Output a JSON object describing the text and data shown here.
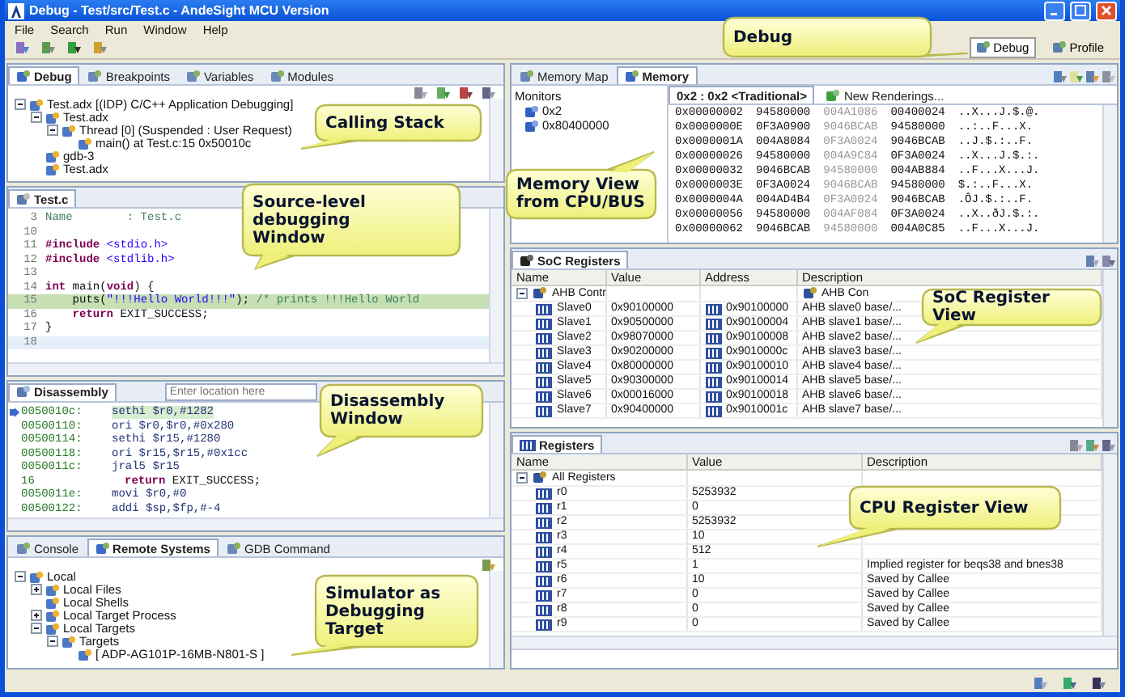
{
  "window": {
    "title": "Debug - Test/src/Test.c - AndeSight MCU Version"
  },
  "menu": [
    "File",
    "Search",
    "Run",
    "Window",
    "Help"
  ],
  "perspectives": [
    {
      "label": "Debug",
      "selected": true
    },
    {
      "label": "Profile",
      "selected": false
    }
  ],
  "debug_view": {
    "tabs": [
      {
        "label": "Debug",
        "selected": true
      },
      {
        "label": "Breakpoints",
        "selected": false
      },
      {
        "label": "Variables",
        "selected": false
      },
      {
        "label": "Modules",
        "selected": false
      }
    ],
    "tree": [
      {
        "label": "Test.adx [(IDP) C/C++ Application Debugging]",
        "children": [
          {
            "label": "Test.adx",
            "children": [
              {
                "label": "Thread [0] (Suspended : User Request)",
                "children": [
                  {
                    "label": "main() at Test.c:15 0x50010c"
                  }
                ]
              }
            ]
          },
          {
            "label": "gdb-3"
          },
          {
            "label": "Test.adx"
          }
        ]
      }
    ]
  },
  "editor": {
    "tab": "Test.c",
    "lines": [
      {
        "num": "3",
        "current": false,
        "cursor": false,
        "tokens": [
          {
            "text": "Name        : Test.c",
            "kind": "comment"
          }
        ]
      },
      {
        "num": "10",
        "current": false,
        "cursor": false
      },
      {
        "num": "11",
        "current": false,
        "cursor": false,
        "tokens": [
          {
            "text": "#include",
            "kind": "keyword"
          },
          {
            "text": " <stdio.h>",
            "kind": "string"
          }
        ]
      },
      {
        "num": "12",
        "current": false,
        "cursor": false,
        "tokens": [
          {
            "text": "#include",
            "kind": "keyword"
          },
          {
            "text": " <stdlib.h>",
            "kind": "string"
          }
        ]
      },
      {
        "num": "13",
        "current": false,
        "cursor": false
      },
      {
        "num": "14",
        "current": false,
        "cursor": false,
        "tokens": [
          {
            "text": "int",
            "kind": "keyword"
          },
          {
            "text": " main(",
            "kind": "plain"
          },
          {
            "text": "void",
            "kind": "keyword"
          },
          {
            "text": ") {",
            "kind": "plain"
          }
        ]
      },
      {
        "num": "15",
        "current": true,
        "cursor": false,
        "tokens": [
          {
            "text": "    puts(",
            "kind": "plain"
          },
          {
            "text": "\"!!!Hello World!!!\"",
            "kind": "string"
          },
          {
            "text": "); ",
            "kind": "plain"
          },
          {
            "text": "/* prints !!!Hello World",
            "kind": "comment"
          }
        ]
      },
      {
        "num": "16",
        "current": false,
        "cursor": false,
        "tokens": [
          {
            "text": "    return",
            "kind": "keyword"
          },
          {
            "text": " EXIT_SUCCESS;",
            "kind": "plain"
          }
        ]
      },
      {
        "num": "17",
        "current": false,
        "cursor": false,
        "tokens": [
          {
            "text": "}",
            "kind": "plain"
          }
        ]
      },
      {
        "num": "18",
        "current": false,
        "cursor": true
      }
    ]
  },
  "disassembly": {
    "tab": "Disassembly",
    "location": {
      "placeholder": "Enter location here"
    },
    "rows": [
      {
        "addr": "0050010c:",
        "code": "sethi $r0,#1282",
        "kind": "instruction",
        "current": true
      },
      {
        "addr": "00500110:",
        "code": "ori $r0,$r0,#0x280",
        "kind": "instruction",
        "current": false
      },
      {
        "addr": "00500114:",
        "code": "sethi $r15,#1280",
        "kind": "instruction",
        "current": false
      },
      {
        "addr": "00500118:",
        "code": "ori $r15,$r15,#0x1cc",
        "kind": "instruction",
        "current": false
      },
      {
        "addr": "0050011c:",
        "code": "jral5 $r15",
        "kind": "instruction",
        "current": false
      },
      {
        "addr": "16",
        "code": "return EXIT_SUCCESS;",
        "kind": "source",
        "current": false
      },
      {
        "addr": "0050011e:",
        "code": "movi $r0,#0",
        "kind": "instruction",
        "current": false
      },
      {
        "addr": "00500122:",
        "code": "addi $sp,$fp,#-4",
        "kind": "instruction",
        "current": false
      }
    ]
  },
  "console": {
    "tabs": [
      {
        "label": "Console",
        "selected": false
      },
      {
        "label": "Remote Systems",
        "selected": true
      },
      {
        "label": "GDB Command",
        "selected": false
      }
    ],
    "tree": [
      {
        "label": "Local",
        "children": [
          {
            "label": "Local Files",
            "collapsed": true
          },
          {
            "label": "Local Shells"
          },
          {
            "label": "Local Target Process",
            "collapsed": true
          },
          {
            "label": "Local Targets",
            "children": [
              {
                "label": "Targets",
                "children": [
                  {
                    "label": "[ ADP-AG101P-16MB-N801-S ]"
                  }
                ]
              }
            ]
          }
        ]
      }
    ]
  },
  "memory": {
    "tabs": [
      {
        "label": "Memory Map",
        "selected": false
      },
      {
        "label": "Memory",
        "selected": true
      }
    ],
    "monitors_label": "Monitors",
    "monitors": [
      "0x2",
      "0x80400000"
    ],
    "rendering_tabs": [
      {
        "label": "0x2 : 0x2 <Traditional>",
        "selected": true
      },
      {
        "label": "New Renderings...",
        "selected": false
      }
    ],
    "rows": [
      {
        "address": "0x00000002",
        "words": [
          "94580000",
          "004A1086",
          "00400024"
        ],
        "ascii": "..X...J.$.@."
      },
      {
        "address": "0x0000000E",
        "words": [
          "0F3A0900",
          "9046BCAB",
          "94580000"
        ],
        "ascii": "..:..F...X."
      },
      {
        "address": "0x0000001A",
        "words": [
          "004A8084",
          "0F3A0024",
          "9046BCAB"
        ],
        "ascii": "..J.$.:..F."
      },
      {
        "address": "0x00000026",
        "words": [
          "94580000",
          "004A9C84",
          "0F3A0024"
        ],
        "ascii": "..X...J.$.:."
      },
      {
        "address": "0x00000032",
        "words": [
          "9046BCAB",
          "94580000",
          "004AB884"
        ],
        "ascii": "..F...X...J."
      },
      {
        "address": "0x0000003E",
        "words": [
          "0F3A0024",
          "9046BCAB",
          "94580000"
        ],
        "ascii": "$.:..F...X."
      },
      {
        "address": "0x0000004A",
        "words": [
          "004AD4B4",
          "0F3A0024",
          "9046BCAB"
        ],
        "ascii": ".ÔJ.$.:..F."
      },
      {
        "address": "0x00000056",
        "words": [
          "94580000",
          "004AF084",
          "0F3A0024"
        ],
        "ascii": "..X..ðJ.$.:."
      },
      {
        "address": "0x00000062",
        "words": [
          "9046BCAB",
          "94580000",
          "004A0C85"
        ],
        "ascii": "..F...X...J."
      }
    ]
  },
  "soc_registers": {
    "tab": "SoC Registers",
    "columns": [
      "Name",
      "Value",
      "Address",
      "Description"
    ],
    "group": {
      "name": "AHB Contr",
      "description": "AHB Con"
    },
    "rows": [
      {
        "name": "Slave0",
        "value": "0x90100000",
        "address": "0x90100000",
        "description": "AHB slave0 base/..."
      },
      {
        "name": "Slave1",
        "value": "0x90500000",
        "address": "0x90100004",
        "description": "AHB slave1 base/..."
      },
      {
        "name": "Slave2",
        "value": "0x98070000",
        "address": "0x90100008",
        "description": "AHB slave2 base/..."
      },
      {
        "name": "Slave3",
        "value": "0x90200000",
        "address": "0x9010000c",
        "description": "AHB slave3 base/..."
      },
      {
        "name": "Slave4",
        "value": "0x80000000",
        "address": "0x90100010",
        "description": "AHB slave4 base/..."
      },
      {
        "name": "Slave5",
        "value": "0x90300000",
        "address": "0x90100014",
        "description": "AHB slave5 base/..."
      },
      {
        "name": "Slave6",
        "value": "0x00016000",
        "address": "0x90100018",
        "description": "AHB slave6 base/..."
      },
      {
        "name": "Slave7",
        "value": "0x90400000",
        "address": "0x9010001c",
        "description": "AHB slave7 base/..."
      }
    ]
  },
  "registers": {
    "tab": "Registers",
    "columns": [
      "Name",
      "Value",
      "Description"
    ],
    "group": "All Registers",
    "rows": [
      {
        "name": "r0",
        "value": "5253932"
      },
      {
        "name": "r1",
        "value": "0"
      },
      {
        "name": "r2",
        "value": "5253932"
      },
      {
        "name": "r3",
        "value": "10"
      },
      {
        "name": "r4",
        "value": "512"
      },
      {
        "name": "r5",
        "value": "1",
        "description": "Implied register for beqs38 and bnes38"
      },
      {
        "name": "r6",
        "value": "10",
        "description": "Saved by Callee"
      },
      {
        "name": "r7",
        "value": "0",
        "description": "Saved by Callee"
      },
      {
        "name": "r8",
        "value": "0",
        "description": "Saved by Callee"
      },
      {
        "name": "r9",
        "value": "0",
        "description": "Saved by Callee"
      }
    ]
  },
  "callouts": [
    {
      "text": "Debug"
    },
    {
      "text": "Calling Stack"
    },
    {
      "text": "Memory View\nfrom CPU/BUS"
    },
    {
      "text": "Source-level\ndebugging\nWindow"
    },
    {
      "text": "SoC Register View"
    },
    {
      "text": "Disassembly Window"
    },
    {
      "text": "CPU Register View"
    },
    {
      "text": "Simulator as\nDebugging\nTarget"
    }
  ]
}
